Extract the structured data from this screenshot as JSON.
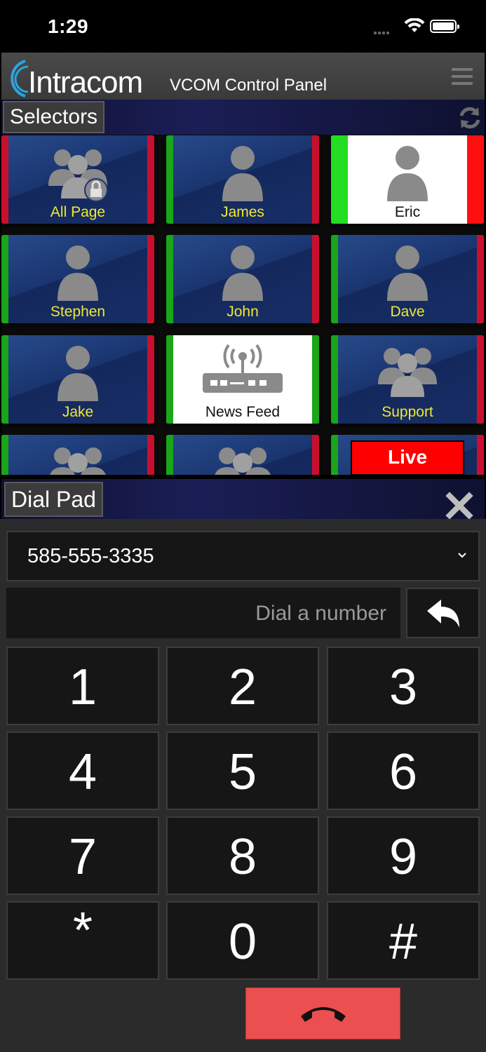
{
  "status": {
    "time": "1:29"
  },
  "header": {
    "logo_text": "Intracom",
    "title": "VCOM Control Panel"
  },
  "selectors": {
    "title": "Selectors",
    "tiles": [
      {
        "label": "All Page",
        "icon": "group-lock-icon",
        "left": "#c8102e",
        "right": "#c8102e"
      },
      {
        "label": "James",
        "icon": "person-icon",
        "left": "#1aa51a",
        "right": "#c8102e"
      },
      {
        "label": "Eric",
        "icon": "person-icon",
        "left": "#22dd22",
        "right": "#ff1010",
        "style": "white"
      },
      {
        "label": "Stephen",
        "icon": "person-icon",
        "left": "#1aa51a",
        "right": "#c8102e"
      },
      {
        "label": "John",
        "icon": "person-icon",
        "left": "#1aa51a",
        "right": "#c8102e"
      },
      {
        "label": "Dave",
        "icon": "person-icon",
        "left": "#1aa51a",
        "right": "#c8102e"
      },
      {
        "label": "Jake",
        "icon": "person-icon",
        "left": "#1aa51a",
        "right": "#c8102e"
      },
      {
        "label": "News Feed",
        "icon": "router-broadcast-icon",
        "left": "#1aa51a",
        "right": "#1aa51a",
        "style": "white"
      },
      {
        "label": "Support",
        "icon": "group-icon",
        "left": "#1aa51a",
        "right": "#c8102e"
      },
      {
        "label": "",
        "icon": "group-icon",
        "left": "#1aa51a",
        "right": "#c8102e"
      },
      {
        "label": "",
        "icon": "group-icon",
        "left": "#1aa51a",
        "right": "#c8102e"
      },
      {
        "label": "Live",
        "icon": "live-badge",
        "left": "#1aa51a",
        "right": "#c8102e"
      }
    ]
  },
  "dialpad": {
    "title": "Dial Pad",
    "selected_number": "585-555-3335",
    "input_placeholder": "Dial a number",
    "keys": [
      "1",
      "2",
      "3",
      "4",
      "5",
      "6",
      "7",
      "8",
      "9",
      "*",
      "0",
      "#"
    ]
  },
  "colors": {
    "accent": "#2aa6e0",
    "hangup": "#ec4f4f",
    "label_yellow": "#f0e830",
    "live": "#ff0000"
  }
}
